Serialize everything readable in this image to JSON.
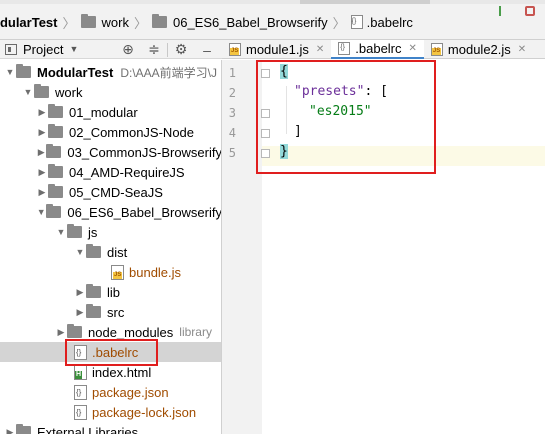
{
  "breadcrumbs": {
    "root": "odularTest",
    "item1": "work",
    "item2": "06_ES6_Babel_Browserify",
    "item3": ".babelrc"
  },
  "project_panel": {
    "title": "Project"
  },
  "tree": {
    "root": {
      "label": "ModularTest",
      "path": "D:\\AAA前端学习\\J"
    },
    "work": "work",
    "f01": "01_modular",
    "f02": "02_CommonJS-Node",
    "f03": "03_CommonJS-Browserify",
    "f04": "04_AMD-RequireJS",
    "f05": "05_CMD-SeaJS",
    "f06": "06_ES6_Babel_Browserify",
    "js": "js",
    "dist": "dist",
    "bundle": "bundle.js",
    "lib": "lib",
    "src": "src",
    "node_modules": "node_modules",
    "library": "library",
    "babelrc": ".babelrc",
    "index": "index.html",
    "package": "package.json",
    "package_lock": "package-lock.json",
    "external": "External Libraries"
  },
  "tabs": [
    {
      "label": "module1.js"
    },
    {
      "label": ".babelrc"
    },
    {
      "label": "module2.js"
    }
  ],
  "editor": {
    "line_numbers": [
      "1",
      "2",
      "3",
      "4",
      "5"
    ],
    "open_brace": "{",
    "presets_key": "\"presets\"",
    "colon_bracket": ": [",
    "preset_value": "\"es2015\"",
    "close_bracket": "]",
    "close_brace": "}"
  },
  "colors": {
    "highlight_box": "#e01e1e",
    "selection": "#d4d4d4",
    "tab_underline": "#4083c9"
  }
}
